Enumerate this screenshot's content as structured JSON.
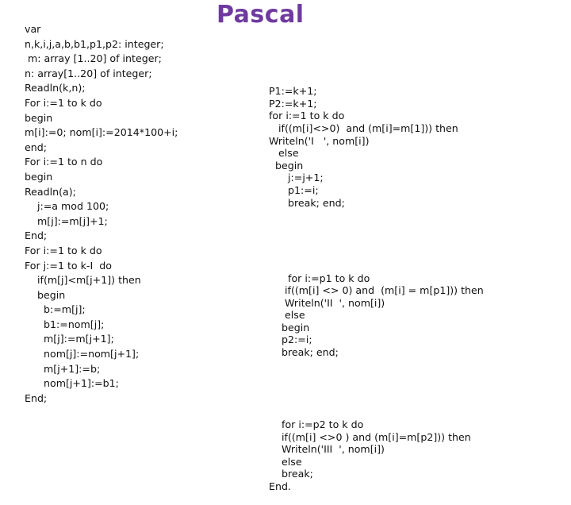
{
  "title": "Pascal",
  "left_code": [
    "var",
    "n,k,i,j,a,b,b1,p1,p2: integer;",
    " m: array [1..20] of integer;",
    "n: array[1..20] of integer;",
    "Readln(k,n);",
    "For i:=1 to k do",
    "begin",
    "m[i]:=0; nom[i]:=2014*100+i;",
    "end;",
    "For i:=1 to n do",
    "begin",
    "Readln(a);",
    "    j:=a mod 100;",
    "    m[j]:=m[j]+1;",
    "End;",
    "For i:=1 to k do",
    "For j:=1 to k-I  do",
    "    if(m[j]<m[j+1]) then",
    "    begin",
    "      b:=m[j];",
    "      b1:=nom[j];",
    "      m[j]:=m[j+1];",
    "      nom[j]:=nom[j+1];",
    "      m[j+1]:=b;",
    "      nom[j+1]:=b1;",
    "End;"
  ],
  "right_code_block1": [
    "P1:=k+1;",
    "P2:=k+1;",
    "for i:=1 to k do",
    "   if((m[i]<>0)  and (m[i]=m[1])) then",
    "Writeln('I   ', nom[i])",
    "   else",
    "  begin",
    "      j:=j+1;",
    "      p1:=i;",
    "      break; end;"
  ],
  "right_code_block2": [
    "      for i:=p1 to k do",
    "     if((m[i] <> 0) and  (m[i] = m[p1])) then",
    "     Writeln('II  ', nom[i])",
    "     else",
    "    begin",
    "    p2:=i;",
    "    break; end;"
  ],
  "right_code_block3": [
    "    for i:=p2 to k do",
    "    if((m[i] <>0 ) and (m[i]=m[p2])) then",
    "    Writeln('III  ', nom[i])",
    "    else",
    "    break;",
    "End."
  ]
}
